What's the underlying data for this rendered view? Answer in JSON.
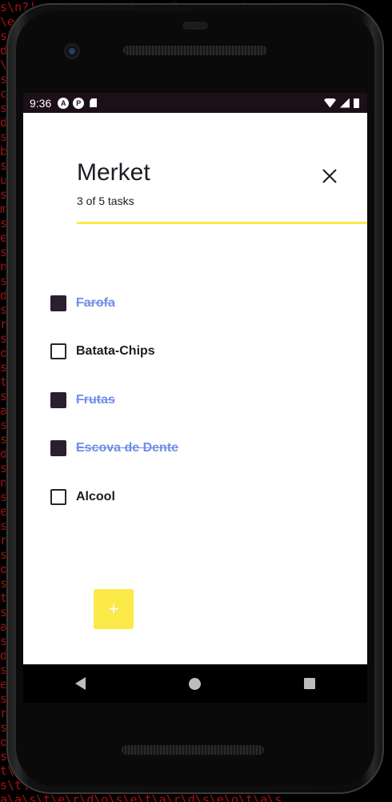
{
  "status_bar": {
    "time": "9:36",
    "icons": [
      "a-circle-icon",
      "p-circle-icon",
      "sd-card-icon"
    ],
    "right_icons": [
      "wifi-icon",
      "signal-icon",
      "battery-icon"
    ]
  },
  "header": {
    "title": "Merket",
    "subtitle": "3 of 5 tasks",
    "close_icon": "close-icon"
  },
  "progress": {
    "completed": 3,
    "total": 5,
    "color": "#fbe94a"
  },
  "tasks": [
    {
      "label": "Farofa",
      "done": true
    },
    {
      "label": "Batata-Chips",
      "done": false
    },
    {
      "label": "Frutas",
      "done": true
    },
    {
      "label": "Escova de Dente",
      "done": true
    },
    {
      "label": "Alcool",
      "done": false
    }
  ],
  "fab": {
    "label": "+",
    "color": "#fbe94a"
  },
  "nav": {
    "back": "back-icon",
    "home": "home-icon",
    "recents": "recents-icon"
  },
  "colors": {
    "done_text": "#6f8ee8",
    "checked_box": "#2a1e30",
    "status_bar": "#1c0f17"
  }
}
